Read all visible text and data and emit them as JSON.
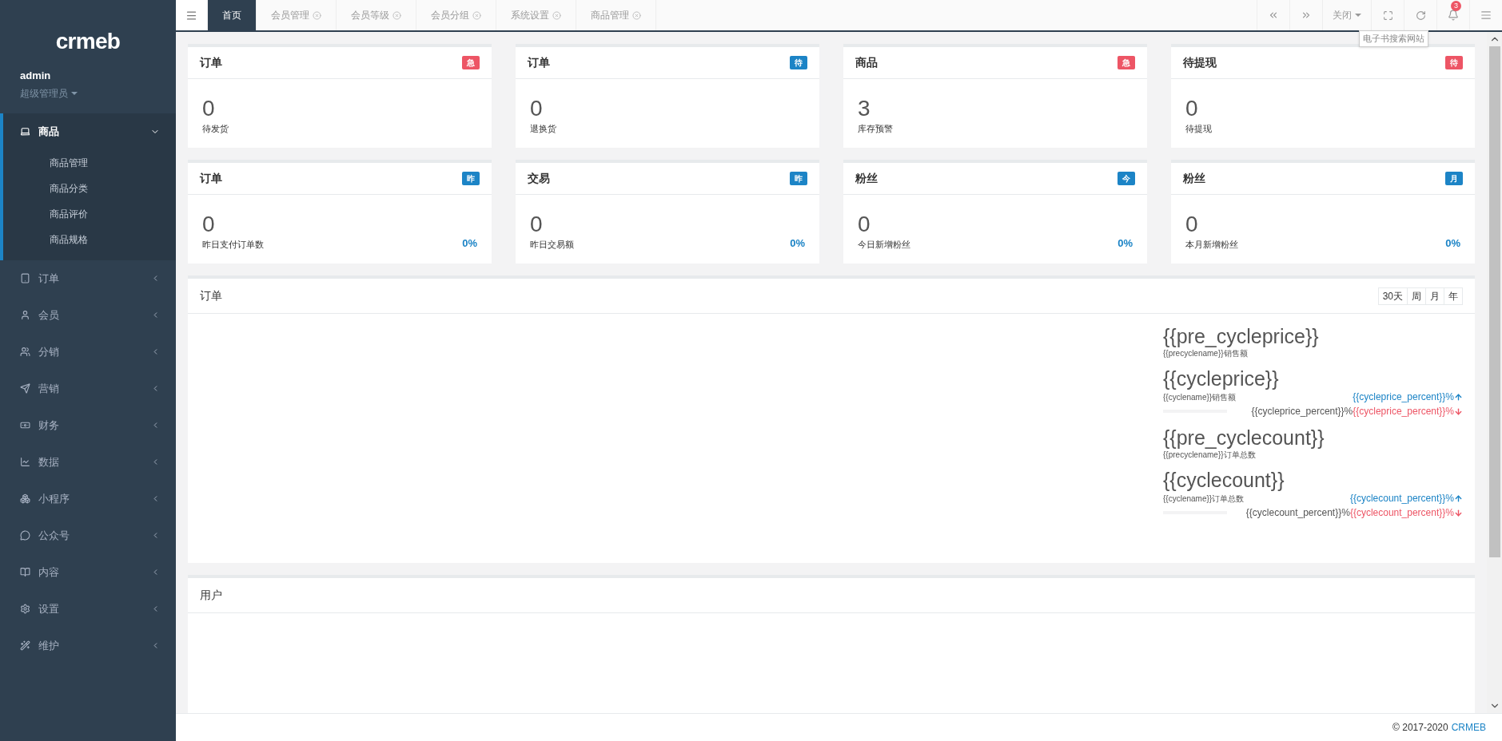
{
  "sidebar": {
    "logo": "crmeb",
    "user": {
      "name": "admin",
      "role": "超级管理员"
    },
    "menu": [
      {
        "label": "商品",
        "expanded": true,
        "children": [
          {
            "label": "商品管理"
          },
          {
            "label": "商品分类"
          },
          {
            "label": "商品评价"
          },
          {
            "label": "商品规格"
          }
        ]
      },
      {
        "label": "订单",
        "expanded": false
      },
      {
        "label": "会员",
        "expanded": false
      },
      {
        "label": "分销",
        "expanded": false
      },
      {
        "label": "营销",
        "expanded": false
      },
      {
        "label": "财务",
        "expanded": false
      },
      {
        "label": "数据",
        "expanded": false
      },
      {
        "label": "小程序",
        "expanded": false
      },
      {
        "label": "公众号",
        "expanded": false
      },
      {
        "label": "内容",
        "expanded": false
      },
      {
        "label": "设置",
        "expanded": false
      },
      {
        "label": "维护",
        "expanded": false
      }
    ]
  },
  "tabs": [
    {
      "label": "首页",
      "selected": true,
      "closable": false
    },
    {
      "label": "会员管理",
      "selected": false,
      "closable": true
    },
    {
      "label": "会员等级",
      "selected": false,
      "closable": true
    },
    {
      "label": "会员分组",
      "selected": false,
      "closable": true
    },
    {
      "label": "系统设置",
      "selected": false,
      "closable": true
    },
    {
      "label": "商品管理",
      "selected": false,
      "closable": true
    }
  ],
  "toolbar": {
    "close_menu": "关闭",
    "tooltip": "电子书搜索网站",
    "notification_count": "3"
  },
  "cards": [
    {
      "title": "订单",
      "badge": "急",
      "color": "#ed5565",
      "value": "0",
      "label": "待发货"
    },
    {
      "title": "订单",
      "badge": "待",
      "color": "#1c84c6",
      "value": "0",
      "label": "退换货"
    },
    {
      "title": "商品",
      "badge": "急",
      "color": "#ed5565",
      "value": "3",
      "label": "库存预警"
    },
    {
      "title": "待提现",
      "badge": "待",
      "color": "#ed5565",
      "value": "0",
      "label": "待提现"
    },
    {
      "title": "订单",
      "badge": "昨",
      "color": "#1c84c6",
      "value": "0",
      "label": "昨日支付订单数",
      "percent": "0%"
    },
    {
      "title": "交易",
      "badge": "昨",
      "color": "#1c84c6",
      "value": "0",
      "label": "昨日交易额",
      "percent": "0%"
    },
    {
      "title": "粉丝",
      "badge": "今",
      "color": "#1c84c6",
      "value": "0",
      "label": "今日新增粉丝",
      "percent": "0%"
    },
    {
      "title": "粉丝",
      "badge": "月",
      "color": "#1c84c6",
      "value": "0",
      "label": "本月新增粉丝",
      "percent": "0%"
    }
  ],
  "order_panel": {
    "title": "订单",
    "range_buttons": [
      "30天",
      "周",
      "月",
      "年"
    ],
    "stats": [
      {
        "value": "{{pre_cycleprice}}",
        "label": "{{precyclename}}销售额"
      },
      {
        "value": "{{cycleprice}}",
        "label": "{{cyclename}}销售额",
        "up": "{{cycleprice_percent}}%",
        "compare": "{{cycleprice_percent}}%",
        "down": "{{cycleprice_percent}}%"
      },
      {
        "value": "{{pre_cyclecount}}",
        "label": "{{precyclename}}订单总数"
      },
      {
        "value": "{{cyclecount}}",
        "label": "{{cyclename}}订单总数",
        "up": "{{cyclecount_percent}}%",
        "compare": "{{cyclecount_percent}}%",
        "down": "{{cyclecount_percent}}%"
      }
    ]
  },
  "user_panel": {
    "title": "用户"
  },
  "footer": {
    "copyright": "© 2017-2020",
    "link": "CRMEB"
  }
}
